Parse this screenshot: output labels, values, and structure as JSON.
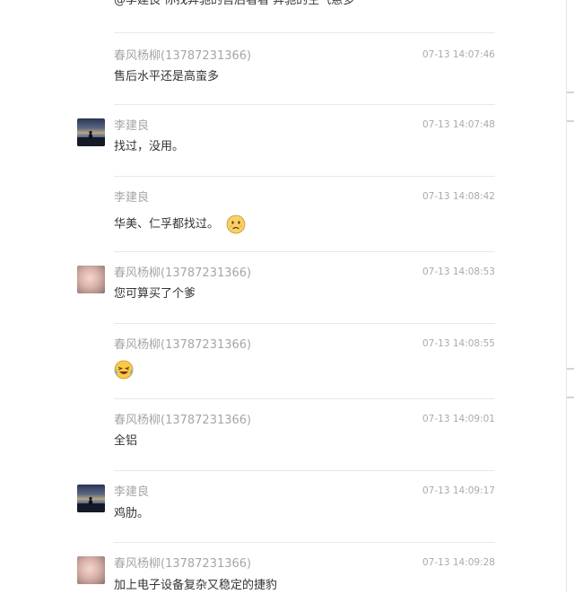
{
  "top_partial_text": "@李建良 你找奔驰的售后看看 奔驰的空气悬多",
  "messages": [
    {
      "sender": "春风杨柳(13787231366)",
      "time": "07-13 14:07:46",
      "text": "售后水平还是高蛮多",
      "avatar": "none"
    },
    {
      "sender": "李建良",
      "time": "07-13 14:07:48",
      "text": "找过，没用。",
      "avatar": "lake-silhouette"
    },
    {
      "sender": "李建良",
      "time": "07-13 14:08:42",
      "text": "华美、仁孚都找过。",
      "emoji": "worried-face-icon",
      "avatar": "none"
    },
    {
      "sender": "春风杨柳(13787231366)",
      "time": "07-13 14:08:53",
      "text": "您可算买了个爹",
      "avatar": "pink-photo"
    },
    {
      "sender": "春风杨柳(13787231366)",
      "time": "07-13 14:08:55",
      "text": "",
      "emoji": "laughing-tears-icon",
      "avatar": "none"
    },
    {
      "sender": "春风杨柳(13787231366)",
      "time": "07-13 14:09:01",
      "text": "全铝",
      "avatar": "none"
    },
    {
      "sender": "李建良",
      "time": "07-13 14:09:17",
      "text": "鸡肋。",
      "avatar": "lake-silhouette"
    },
    {
      "sender": "春风杨柳(13787231366)",
      "time": "07-13 14:09:28",
      "text": "加上电子设备复杂又稳定的捷豹",
      "avatar": "pink-photo"
    }
  ]
}
